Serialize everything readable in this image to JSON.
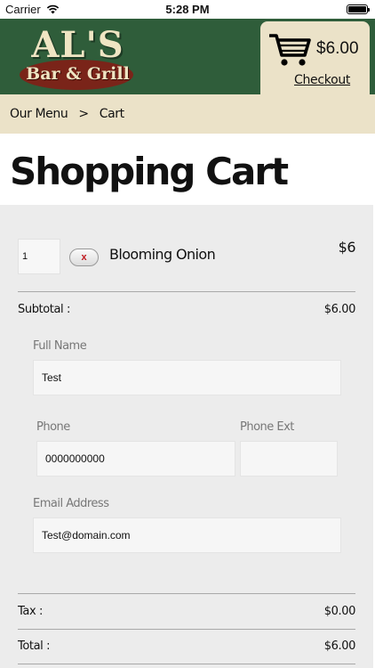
{
  "status_bar": {
    "carrier": "Carrier",
    "time": "5:28 PM"
  },
  "header": {
    "logo_main": "AL'S",
    "logo_sub": "Bar & Grill",
    "cart_total": "$6.00",
    "checkout_label": "Checkout"
  },
  "breadcrumb": {
    "parent": "Our Menu",
    "separator": ">",
    "current": "Cart"
  },
  "page_title": "Shopping Cart",
  "cart_items": [
    {
      "quantity": "1",
      "remove_label": "x",
      "name": "Blooming Onion",
      "price": "$6"
    }
  ],
  "summary": {
    "subtotal_label": "Subtotal :",
    "subtotal_value": "$6.00",
    "tax_label": "Tax :",
    "tax_value": "$0.00",
    "total_label": "Total :",
    "total_value": "$6.00"
  },
  "form": {
    "full_name_label": "Full Name",
    "full_name_value": "Test",
    "phone_label": "Phone",
    "phone_value": "0000000000",
    "phone_ext_label": "Phone Ext",
    "phone_ext_value": "",
    "email_label": "Email Address",
    "email_value": "Test@domain.com"
  },
  "colors": {
    "header_green": "#2f5d3a",
    "cream": "#ebe2c8",
    "logo_red": "#7a2419",
    "remove_red": "#c0171d"
  },
  "icons": [
    "wifi-icon",
    "battery-icon",
    "shopping-cart-icon",
    "close-icon"
  ]
}
